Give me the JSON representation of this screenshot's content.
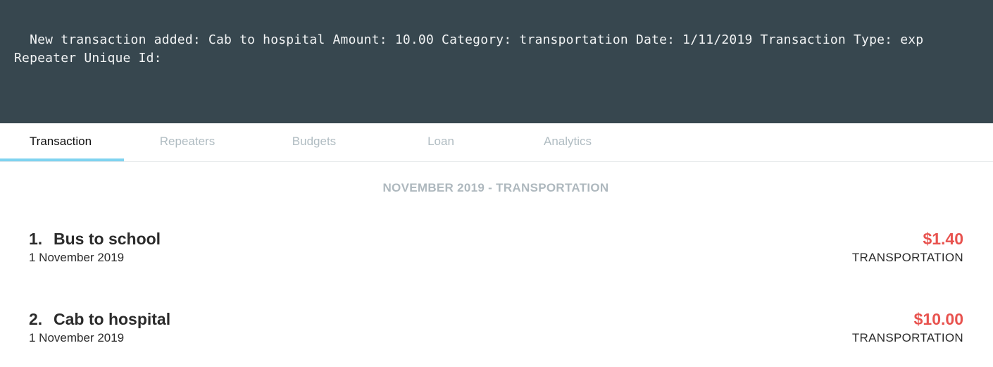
{
  "console": {
    "message": "New transaction added: Cab to hospital Amount: 10.00 Category: transportation Date: 1/11/2019 Transaction Type: exp Repeater Unique Id:"
  },
  "tabs": [
    {
      "label": "Transaction",
      "active": true
    },
    {
      "label": "Repeaters",
      "active": false
    },
    {
      "label": "Budgets",
      "active": false
    },
    {
      "label": "Loan",
      "active": false
    },
    {
      "label": "Analytics",
      "active": false
    }
  ],
  "section": {
    "title": "NOVEMBER 2019 - TRANSPORTATION"
  },
  "transactions": [
    {
      "index": "1.",
      "name": "Bus to school",
      "date": "1 November 2019",
      "amount": "$1.40",
      "category": "TRANSPORTATION"
    },
    {
      "index": "2.",
      "name": "Cab to hospital",
      "date": "1 November 2019",
      "amount": "$10.00",
      "category": "TRANSPORTATION"
    }
  ],
  "colors": {
    "console_bg": "#37474f",
    "tab_indicator": "#7fd3f0",
    "expense_amount": "#e8534f",
    "inactive_tab": "#b0bcc2"
  }
}
